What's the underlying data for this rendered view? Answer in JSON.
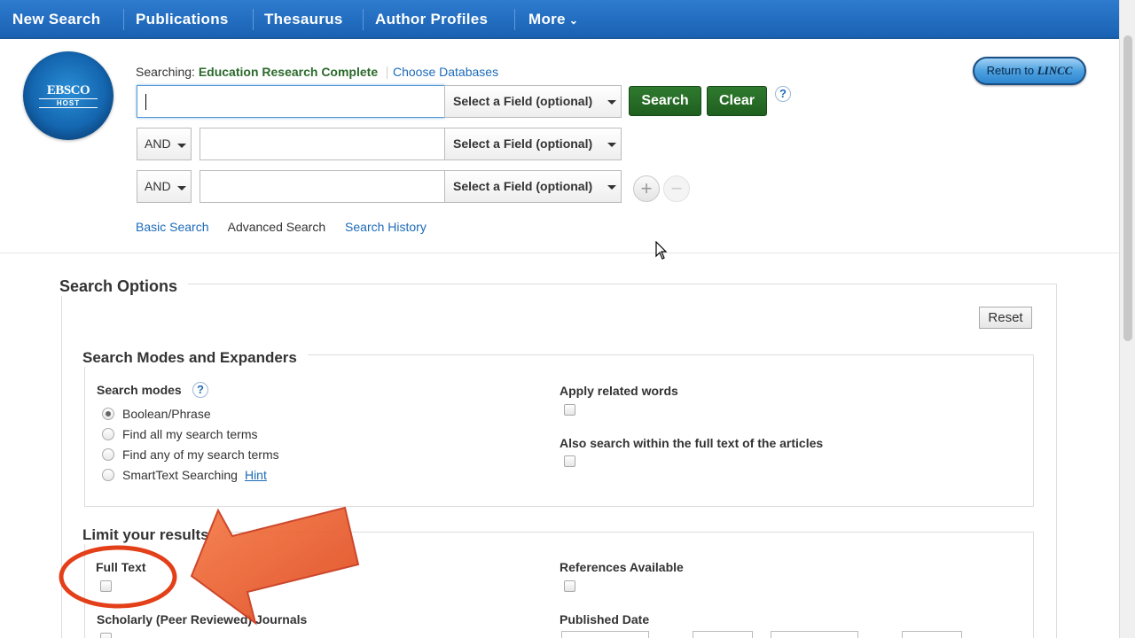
{
  "nav": {
    "items": [
      "New Search",
      "Publications",
      "Thesaurus",
      "Author Profiles",
      "More"
    ]
  },
  "logo": {
    "line1": "EBSCO",
    "line2": "HOST"
  },
  "searching": {
    "prefix": "Searching:",
    "database": "Education Research Complete",
    "choose_link": "Choose Databases"
  },
  "search_rows": {
    "field_select": "Select a Field (optional)",
    "bool_operator": "AND"
  },
  "buttons": {
    "search": "Search",
    "clear": "Clear",
    "help": "?",
    "add_row": "+",
    "remove_row": "−",
    "return_prefix": "Return to",
    "return_brand": "LINCC"
  },
  "tabs": {
    "basic": "Basic Search",
    "advanced": "Advanced Search",
    "history": "Search History"
  },
  "options": {
    "title": "Search Options",
    "reset": "Reset",
    "modes_section": "Search Modes and Expanders",
    "modes_label": "Search modes",
    "modes": [
      "Boolean/Phrase",
      "Find all my search terms",
      "Find any of my search terms",
      "SmartText Searching"
    ],
    "selected_mode": "Boolean/Phrase",
    "hint": "Hint",
    "apply_related": "Apply related words",
    "also_full_text": "Also search within the full text of the articles",
    "limit_section": "Limit your results",
    "full_text": "Full Text",
    "references": "References Available",
    "scholarly": "Scholarly (Peer Reviewed) Journals",
    "published_date": "Published Date"
  },
  "colors": {
    "nav_bg": "#1a62b3",
    "green_button": "#2a6e2a",
    "link": "#1d6bb8",
    "annotation": "#e5481e"
  }
}
